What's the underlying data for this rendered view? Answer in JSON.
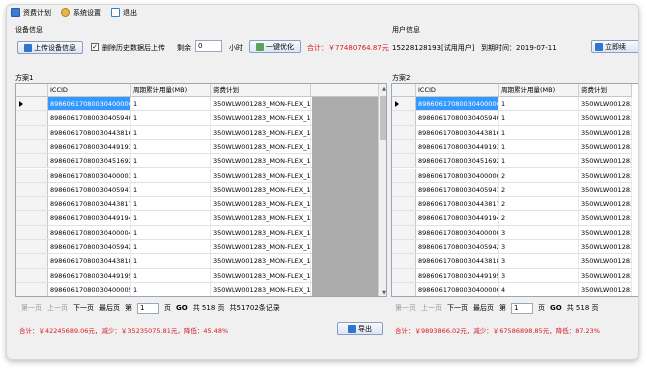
{
  "menu": {
    "plan": "资费计划",
    "settings": "系统设置",
    "exit": "退出"
  },
  "device": {
    "section_title": "设备信息",
    "upload_button": "上传设备信息",
    "delete_history_label": "删除历史数据后上传",
    "delete_history_checked": "✓",
    "remaining_label": "剩余",
    "remaining_value": "0",
    "hours_label": "小时",
    "optimize_button": "一键优化",
    "total_label": "合计：￥77480764.87元"
  },
  "user": {
    "section_title": "用户信息",
    "phone": "15228128193[试用用户]",
    "expire": "到期时间：2019-07-11",
    "renew_button": "立即续"
  },
  "plan1": {
    "title": "方案1",
    "columns": [
      "ICCID",
      "周期累计用量(MB)",
      "资费计划"
    ],
    "rows": [
      [
        "898606170800304000002",
        "1",
        "350WLW001283_MON-FLEX_10M"
      ],
      [
        "898606170800304059401",
        "1",
        "350WLW001283_MON-FLEX_10M"
      ],
      [
        "898606170800304438161",
        "1",
        "350WLW001283_MON-FLEX_10M"
      ],
      [
        "898606170800304491931",
        "1",
        "350WLW001283_MON-FLEX_10M"
      ],
      [
        "898606170800304516921",
        "1",
        "350WLW001283_MON-FLEX_10M"
      ],
      [
        "898606170800304000032",
        "1",
        "350WLW001283_MON-FLEX_10M"
      ],
      [
        "898606170800304059412",
        "1",
        "350WLW001283_MON-FLEX_10M"
      ],
      [
        "898606170800304438172",
        "1",
        "350WLW001283_MON-FLEX_10M"
      ],
      [
        "898606170800304491942",
        "1",
        "350WLW001283_MON-FLEX_10M"
      ],
      [
        "898606170800304000043",
        "1",
        "350WLW001283_MON-FLEX_10M"
      ],
      [
        "898606170800304059423",
        "1",
        "350WLW001283_MON-FLEX_10M"
      ],
      [
        "898606170800304438183",
        "1",
        "350WLW001283_MON-FLEX_10M"
      ],
      [
        "898606170800304491953",
        "1",
        "350WLW001283_MON-FLEX_10M"
      ],
      [
        "898606170800304000054",
        "1",
        "350WLW001283_MON-FLEX_10M"
      ]
    ],
    "pager": {
      "first": "第一页",
      "prev": "上一页",
      "next": "下一页",
      "last": "最后页",
      "page_prefix": "第",
      "page_value": "1",
      "page_suffix": "页",
      "go": "GO",
      "total_pages": "共 518 页",
      "total_records": "共51702条记录"
    },
    "totals": "合计：￥42245689.06元，减少：￥35235075.81元，降低：45.48%",
    "export_button": "导出"
  },
  "plan2": {
    "title": "方案2",
    "columns": [
      "ICCID",
      "周期累计用量(MB)",
      "资费计划"
    ],
    "rows": [
      [
        "898606170800304000002",
        "1",
        "350WLW001283_"
      ],
      [
        "898606170800304059401",
        "1",
        "350WLW001283_"
      ],
      [
        "898606170800304438161",
        "1",
        "350WLW001283_"
      ],
      [
        "898606170800304491931",
        "1",
        "350WLW001283_"
      ],
      [
        "898606170800304516921",
        "1",
        "350WLW001283_"
      ],
      [
        "898606170800304000003",
        "2",
        "350WLW001283_"
      ],
      [
        "898606170800304059412",
        "2",
        "350WLW001283_"
      ],
      [
        "898606170800304438172",
        "2",
        "350WLW001283_"
      ],
      [
        "898606170800304491942",
        "2",
        "350WLW001283_"
      ],
      [
        "898606170800304000004",
        "3",
        "350WLW001283_"
      ],
      [
        "898606170800304059423",
        "3",
        "350WLW001283_"
      ],
      [
        "898606170800304438183",
        "3",
        "350WLW001283_"
      ],
      [
        "898606170800304491953",
        "3",
        "350WLW001283_"
      ],
      [
        "898606170800304000005",
        "4",
        "350WLW001283_"
      ]
    ],
    "pager": {
      "first": "第一页",
      "prev": "上一页",
      "next": "下一页",
      "last": "最后页",
      "page_prefix": "第",
      "page_value": "1",
      "page_suffix": "页",
      "go": "GO",
      "total_pages": "共 518 页"
    },
    "totals": "合计：￥9893866.02元，减少：￥67586898.85元，降低：87.23%"
  },
  "colors": {
    "selected_row": "#3399ff",
    "total_red": "#d6191f"
  }
}
